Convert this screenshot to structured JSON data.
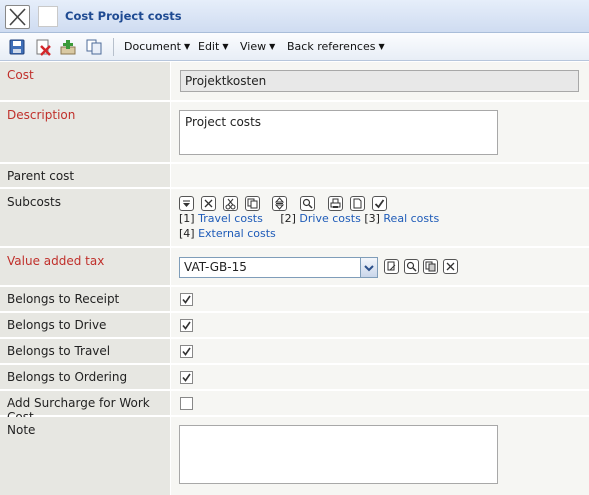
{
  "window": {
    "title": "Cost Project costs"
  },
  "toolbar": {
    "icons": [
      "save-icon",
      "delete-icon",
      "add-record-icon",
      "copy-icon"
    ],
    "menus": [
      "Document",
      "Edit",
      "View",
      "Back references"
    ]
  },
  "form": {
    "cost": {
      "label": "Cost",
      "value": "Projektkosten"
    },
    "description": {
      "label": "Description",
      "value": "Project costs"
    },
    "parent_cost": {
      "label": "Parent cost"
    },
    "subcosts": {
      "label": "Subcosts",
      "icons": [
        "filter-icon",
        "remove-icon",
        "cut-icon",
        "copy-icon",
        "move-icon",
        "search-icon",
        "print-icon",
        "document-icon",
        "confirm-icon"
      ],
      "items": [
        {
          "num": "[1]",
          "name": "Travel costs"
        },
        {
          "num": "[2]",
          "name": "Drive costs"
        },
        {
          "num": "[3]",
          "name": "Real costs"
        },
        {
          "num": "[4]",
          "name": "External costs"
        }
      ]
    },
    "vat": {
      "label": "Value added tax",
      "selected": "VAT-GB-15",
      "icons": [
        "edit-icon",
        "search-icon",
        "copy-icon",
        "clear-icon"
      ]
    },
    "belongs_receipt": {
      "label": "Belongs to Receipt",
      "checked": true
    },
    "belongs_drive": {
      "label": "Belongs to Drive",
      "checked": true
    },
    "belongs_travel": {
      "label": "Belongs to Travel",
      "checked": true
    },
    "belongs_ordering": {
      "label": "Belongs to Ordering",
      "checked": true
    },
    "add_surcharge": {
      "label": "Add Surcharge for Work Cost",
      "checked": false
    },
    "note": {
      "label": "Note",
      "value": ""
    }
  },
  "colors": {
    "required_label": "#c0302b",
    "link": "#1e5bb8",
    "title": "#1e4a92"
  }
}
